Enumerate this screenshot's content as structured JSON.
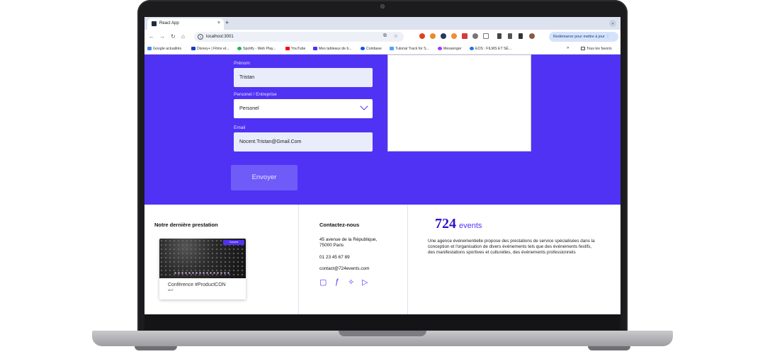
{
  "browser": {
    "tab_title": "React App",
    "tab_close": "×",
    "new_tab": "+",
    "tab_dropdown": "⌄",
    "nav_back": "←",
    "nav_forward": "→",
    "nav_reload": "↻",
    "nav_home": "⌂",
    "url": "localhost:3001",
    "restart_label": "Redémarrer pour mettre à jour",
    "bookmarks": [
      {
        "label": "Google actualités",
        "icon": "google-news-icon",
        "color": "#4285f4"
      },
      {
        "label": "Disney+ | Films et...",
        "icon": "disney-icon",
        "color": "#113ccf"
      },
      {
        "label": "Spotify - Web Play...",
        "icon": "spotify-icon",
        "color": "#1db954"
      },
      {
        "label": "YouTube",
        "icon": "youtube-icon",
        "color": "#ff0000"
      },
      {
        "label": "Mes tableaux de b...",
        "icon": "trello-icon",
        "color": "#5032f5"
      },
      {
        "label": "Coinbase",
        "icon": "coinbase-icon",
        "color": "#0052ff"
      },
      {
        "label": "Tutorial Track for S...",
        "icon": "tutorial-icon",
        "color": "#4aa3ff"
      },
      {
        "label": "Messenger",
        "icon": "messenger-icon",
        "color": "#a334fa"
      },
      {
        "label": "EOS : FILMS ET SÉ...",
        "icon": "eos-icon",
        "color": "#1b78e2"
      }
    ],
    "bookmarks_more": "»",
    "all_bookmarks": "Tous les favoris"
  },
  "form": {
    "prenom_label": "Prénom",
    "prenom_value": "Tristan",
    "type_label": "Personel / Entreprise",
    "type_value": "Personel",
    "email_label": "Email",
    "email_value": "Nocent.Tristan@Gmail.Com",
    "submit_label": "Envoyer"
  },
  "footer": {
    "last_title": "Notre dernière prestation",
    "card_badge": "Concert",
    "card_title": "Conférence #ProductCON",
    "card_sub": "AKIT",
    "contact_title": "Contactez-nous",
    "address_line1": "45 avenue de la République,",
    "address_line2": "75000 Paris",
    "phone": "01 23 45 67 89",
    "email": "contact@724events.com",
    "logo_number": "724",
    "logo_word": "events",
    "description": "Une agence événementielle propose des prestations de service spécialisées dans la conception et l'organisation de divers événements tels que des événements festifs, des manifestations sportives et culturelles, des événements professionnels"
  },
  "colors": {
    "brand": "#5032f5",
    "button": "#6f5bf8"
  }
}
